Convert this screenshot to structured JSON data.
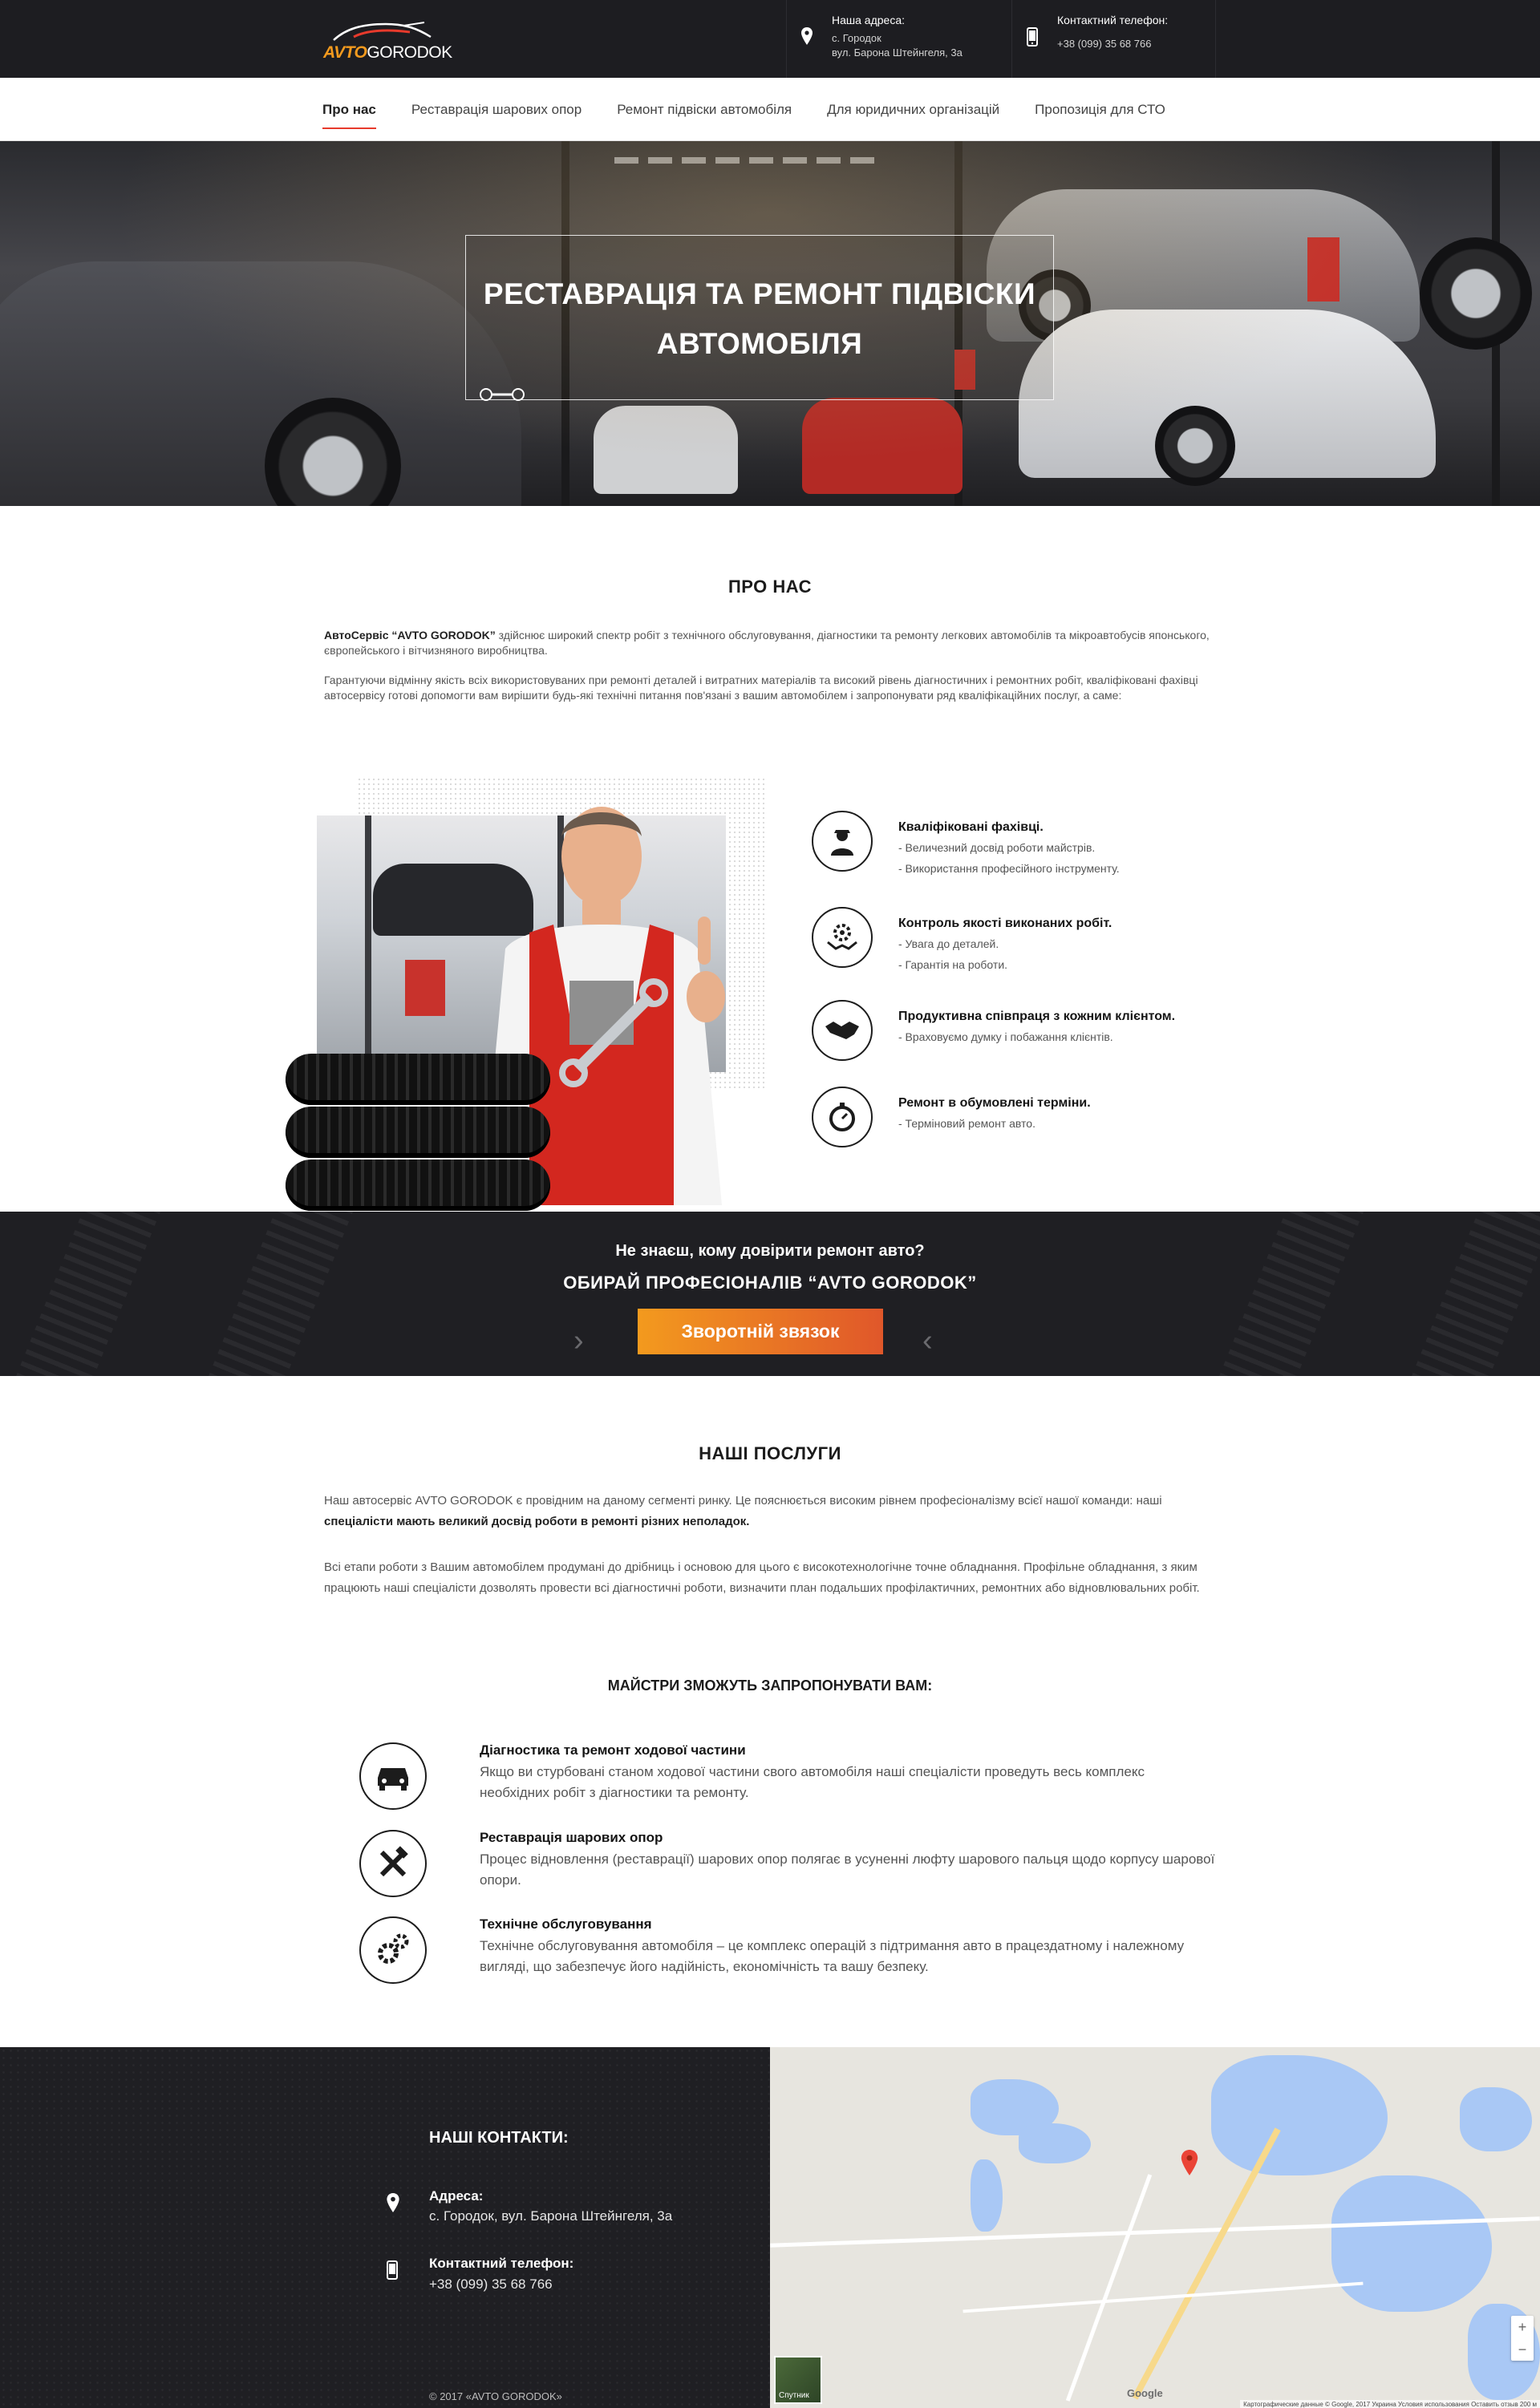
{
  "header": {
    "logo": {
      "part1": "AVTO",
      "part2": "GORODOK"
    },
    "address": {
      "label": "Наша адреса:",
      "line1": "с. Городок",
      "line2": "вул. Барона Штейнгеля, 3а"
    },
    "phone": {
      "label": "Контактний телефон:",
      "value": "+38 (099) 35 68 766"
    }
  },
  "nav": {
    "items": [
      {
        "label": "Про нас",
        "active": true
      },
      {
        "label": "Реставрація шарових опор"
      },
      {
        "label": "Ремонт підвіски автомобіля"
      },
      {
        "label": "Для юридичних організацій"
      },
      {
        "label": "Пропозиція для СТО"
      }
    ]
  },
  "hero": {
    "line1": "РЕСТАВРАЦІЯ ТА РЕМОНТ ПІДВІСКИ",
    "line2": "АВТОМОБІЛЯ"
  },
  "about": {
    "title": "ПРО НАС",
    "p1_bold": "АвтоСервіс “AVTO GORODOK”",
    "p1_rest": " здійснює широкий спектр робіт з технічного обслуговування, діагностики та ремонту легкових автомобілів та мікроавтобусів японського, європейського і вітчизняного виробництва.",
    "p2": "Гарантуючи відмінну якість всіх використовуваних при ремонті деталей і витратних матеріалів та високий рівень діагностичних і ремонтних робіт, кваліфіковані фахівці автосервісу готові допомогти вам вирішити будь-які технічні питання пов'язані з вашим автомобілем і запропонувати ряд кваліфікаційних послуг, а саме:",
    "features": [
      {
        "icon": "mechanic-icon",
        "title": "Кваліфіковані фахівці.",
        "items": [
          "- Величезний досвід роботи майстрів.",
          "- Використання професійного інструменту."
        ]
      },
      {
        "icon": "quality-gear-icon",
        "title": "Контроль якості виконаних робіт.",
        "items": [
          "- Увага до деталей.",
          "- Гарантія на роботи."
        ]
      },
      {
        "icon": "handshake-icon",
        "title": "Продуктивна співпраця з кожним клієнтом.",
        "items": [
          "- Враховуємо думку і побажання клієнтів."
        ]
      },
      {
        "icon": "stopwatch-icon",
        "title": "Ремонт в обумовлені терміни.",
        "items": [
          "- Терміновий ремонт авто."
        ]
      }
    ]
  },
  "cta": {
    "question": "Не знаєш, кому довірити ремонт авто?",
    "headline": "ОБИРАЙ ПРОФЕСІОНАЛІВ “AVTO GORODOK”",
    "button": "Зворотній звязок"
  },
  "services": {
    "title": "НАШІ ПОСЛУГИ",
    "p1_a": "Наш автосервіс AVTO GORODOK є провідним на даному сегменті ринку. Це пояснюється високим рівнем професіоналізму всієї нашої команди: наші ",
    "p1_b": "спеціалісти мають великий досвід роботи в ремонті різних неполадок.",
    "p2": "Всі етапи роботи з Вашим автомобілем продумані до дрібниць і основою для цього є високотехнологічне точне обладнання. Профільне обладнання, з яким працюють наші спеціалісти дозволять провести всі діагностичні роботи, визначити план подальших профілактичних, ремонтних або відновлювальних робіт.",
    "subtitle": "МАЙСТРИ ЗМОЖУТЬ ЗАПРОПОНУВАТИ ВАМ:",
    "items": [
      {
        "icon": "car-diagnostic-icon",
        "title": "Діагностика та ремонт ходової частини",
        "desc": "Якщо ви стурбовані станом ходової частини свого автомобіля наші спеціалісти  проведуть весь комплекс необхідних робіт з діагностики та ремонту."
      },
      {
        "icon": "tools-icon",
        "title": "Реставрація шарових опор",
        "desc": "Процес відновлення (реставрації) шарових  опор полягає в усуненні люфту шарового пальця щодо корпусу шарової  опори."
      },
      {
        "icon": "gears-icon",
        "title": "Технічне обслуговування",
        "desc": "Технічне обслуговування автомобіля – це комплекс операцій з підтримання авто в працездатному і належному вигляді, що забезпечує його надійність, економічність та вашу безпеку."
      }
    ]
  },
  "footer": {
    "title": "НАШІ КОНТАКТИ:",
    "address_label": "Адреса:",
    "address_value": "с. Городок, вул. Барона Штейнгеля, 3а",
    "phone_label": "Контактний телефон:",
    "phone_value": "+38 (099) 35 68 766",
    "copyright": "© 2017  «AVTO GORODOK»"
  },
  "map": {
    "satellite_label": "Спутник",
    "google": "Google",
    "attribution": "Картографические данные © Google, 2017   Украина   Условия использования   Оставить отзыв   200 м"
  }
}
